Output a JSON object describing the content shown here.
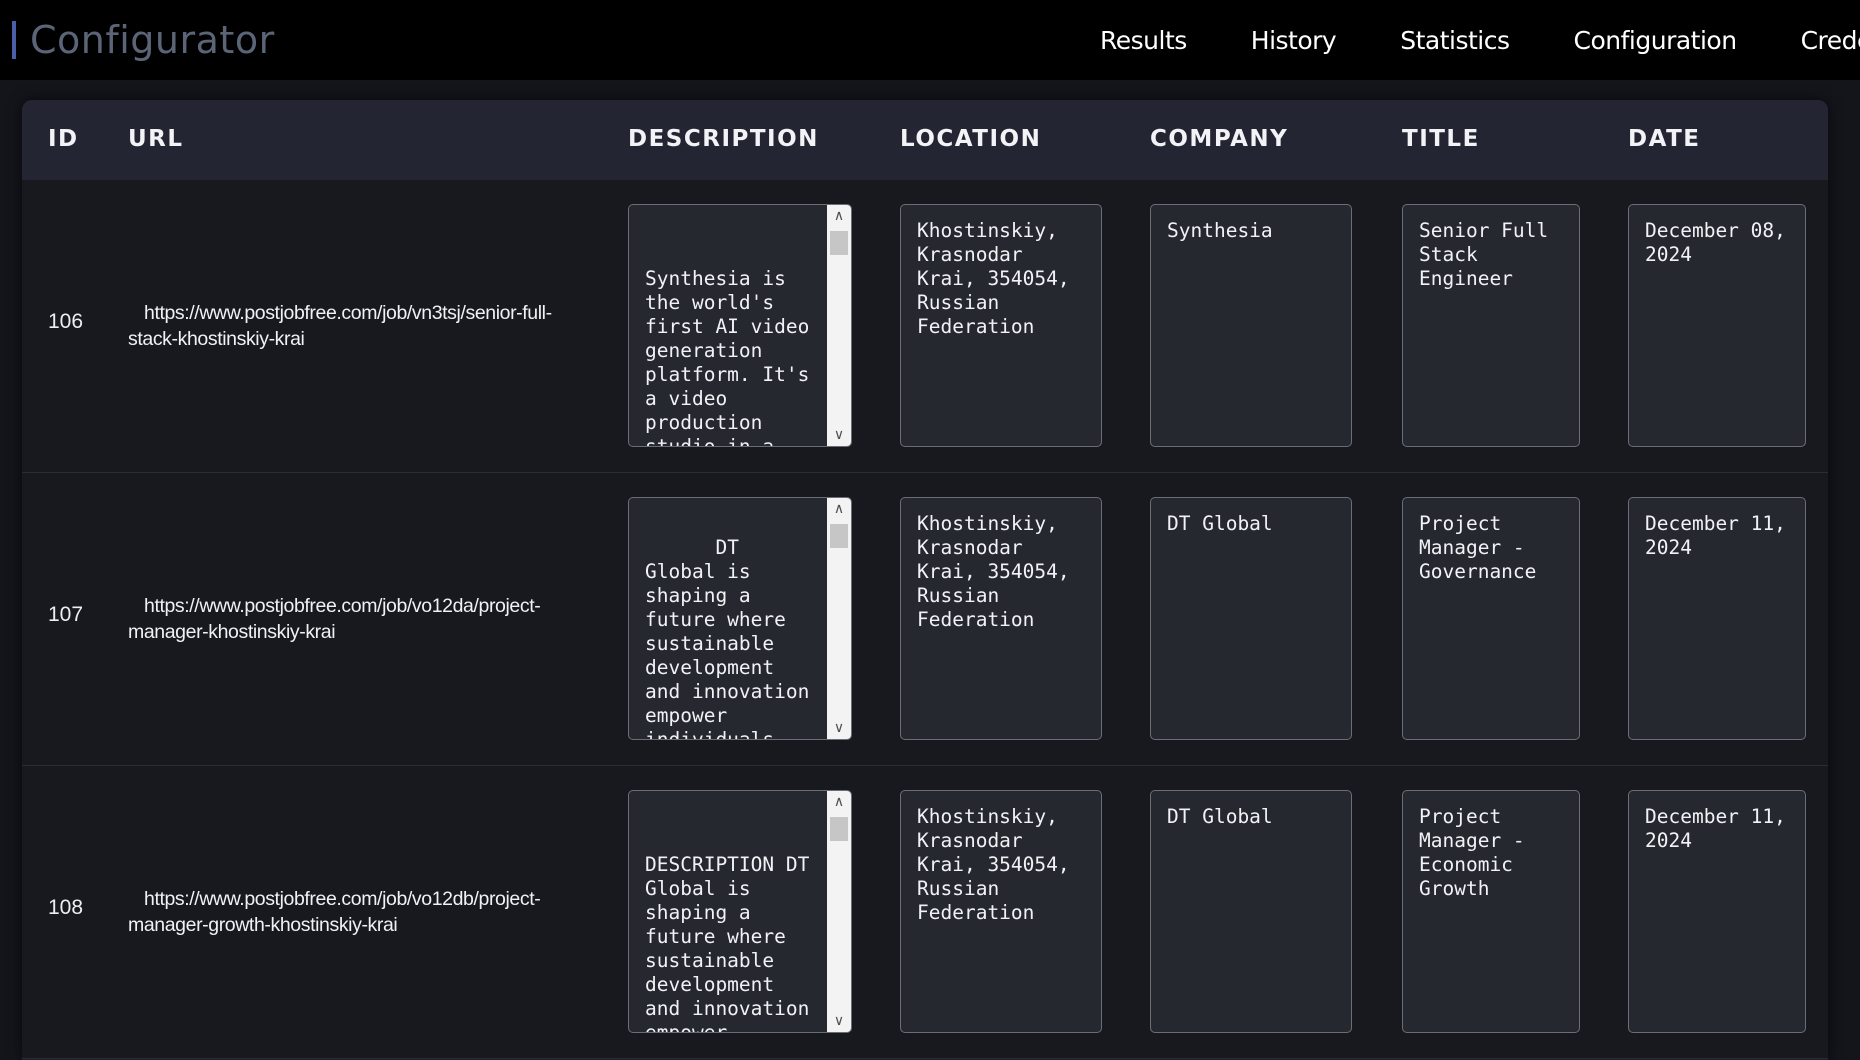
{
  "app": {
    "title": "Configurator"
  },
  "nav": {
    "items": [
      "Results",
      "History",
      "Statistics",
      "Configuration",
      "Credentials"
    ]
  },
  "table": {
    "columns": [
      "ID",
      "URL",
      "DESCRIPTION",
      "LOCATION",
      "COMPANY",
      "TITLE",
      "DATE"
    ],
    "rows": [
      {
        "id": "106",
        "url": "https://www.postjobfree.com/job/vn3tsj/senior-full-stack-khostinskiy-krai",
        "description": "Synthesia is the world's first AI video generation platform. It's a video production studio in a browser; no cameras, no",
        "location": "Khostinskiy, Krasnodar Krai, 354054, Russian Federation",
        "company": "Synthesia",
        "title": "Senior Full Stack Engineer",
        "date": "December 08, 2024"
      },
      {
        "id": "107",
        "url": "https://www.postjobfree.com/job/vo12da/project-manager-khostinskiy-krai",
        "description": "DT Global is shaping a future where sustainable development and innovation empower individuals, communities, and nations",
        "location": "Khostinskiy, Krasnodar Krai, 354054, Russian Federation",
        "company": "DT Global",
        "title": "Project Manager - Governance",
        "date": "December 11, 2024"
      },
      {
        "id": "108",
        "url": "https://www.postjobfree.com/job/vo12db/project-manager-growth-khostinskiy-krai",
        "description": "DESCRIPTION DT Global is shaping a future where sustainable development and innovation empower individuals, communities",
        "location": "Khostinskiy, Krasnodar Krai, 354054, Russian Federation",
        "company": "DT Global",
        "title": "Project Manager - Economic Growth",
        "date": "December 11, 2024"
      }
    ]
  }
}
